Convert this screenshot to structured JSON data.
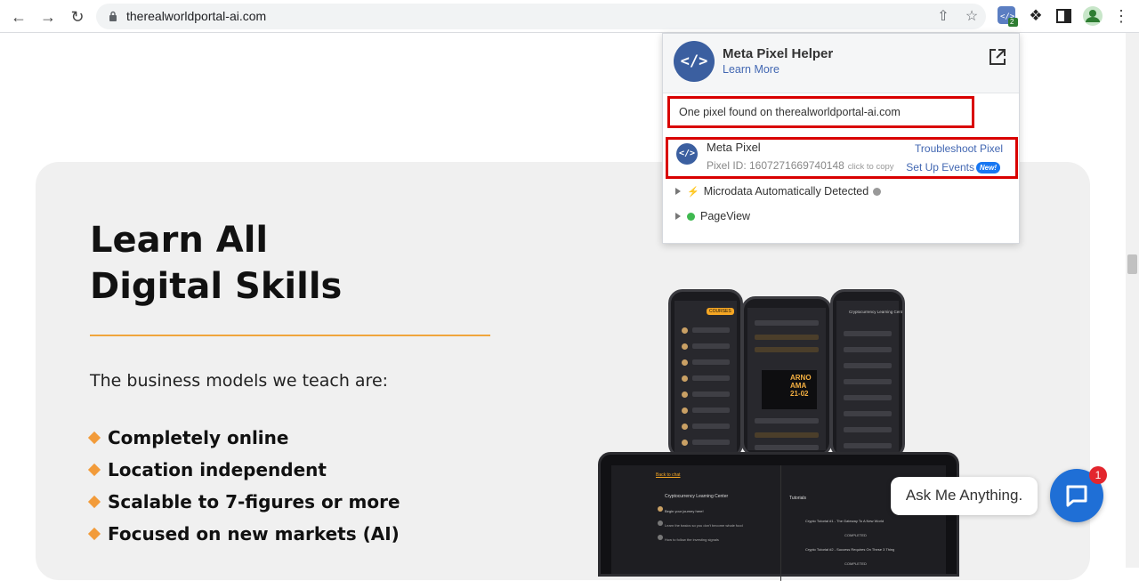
{
  "browser": {
    "url": "therealworldportal-ai.com",
    "extension_badge_count": "2"
  },
  "hero": {
    "title_line1": "Learn All",
    "title_line2": "Digital Skills",
    "subtitle": "The business models we teach are:",
    "bullets": [
      "Completely online",
      "Location independent",
      "Scalable to 7-figures or more",
      "Focused on new markets (AI)"
    ],
    "accent_color": "#f29b3a",
    "phone_screen_text": {
      "left": "COURSES",
      "middle": "ARNO AMA 21-02",
      "right": "Cryptocurrency Learning Center"
    },
    "laptop_screen_text": {
      "back": "Back to chat",
      "learning_center": "Cryptocurrency Learning Center",
      "tutorials": "Tutorials",
      "items": [
        "Begin your journey here!",
        "Learn the basics so you don't become whale food",
        "How to follow the investing signals"
      ],
      "tutorial_items": [
        "Crypto Tutorial #1 - The Gateway To A New World",
        "Crypto Tutorial #2 - Success Requires On These 3 Things"
      ],
      "completed": "COMPLETED"
    }
  },
  "pixel_helper": {
    "title": "Meta Pixel Helper",
    "learn_more": "Learn More",
    "found_message": "One pixel found on therealworldportal-ai.com",
    "pixel_name": "Meta Pixel",
    "pixel_id": "Pixel ID: 1607271669740148",
    "click_to_copy": "click to copy",
    "troubleshoot": "Troubleshoot Pixel",
    "setup_events": "Set Up Events",
    "new_badge": "New!",
    "events": [
      "Microdata Automatically Detected",
      "PageView"
    ],
    "brand_color": "#3b5fa0",
    "highlight_color": "#d90000"
  },
  "chat": {
    "prompt": "Ask Me Anything.",
    "unread": "1",
    "color": "#1f6fd6"
  }
}
